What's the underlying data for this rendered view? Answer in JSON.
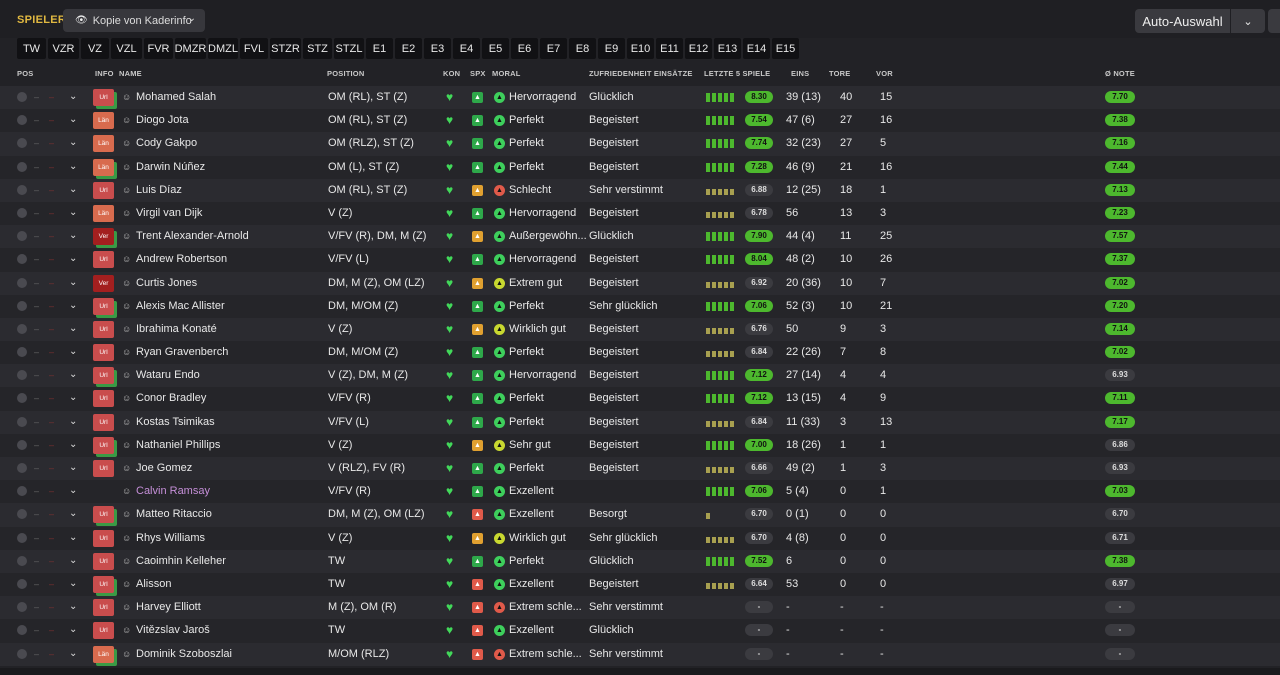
{
  "header": {
    "section_label": "SPIELER",
    "view_label": "Kopie von Kaderinfo",
    "auto_label": "Auto-Auswahl"
  },
  "positions": [
    "TW",
    "VZR",
    "VZ",
    "VZL",
    "FVR",
    "DMZR",
    "DMZL",
    "FVL",
    "STZR",
    "STZ",
    "STZL",
    "E1",
    "E2",
    "E3",
    "E4",
    "E5",
    "E6",
    "E7",
    "E8",
    "E9",
    "E10",
    "E11",
    "E12",
    "E13",
    "E14",
    "E15"
  ],
  "columns": {
    "pos": "POS",
    "info": "INFO",
    "name": "NAME",
    "position": "POSITION",
    "kon": "KON",
    "spx": "SPX",
    "moral": "MORAL",
    "zufriedenheit": "ZUFRIEDENHEIT EINSÄTZE",
    "letzte5": "LETZTE 5 SPIELE",
    "eins": "EINS",
    "tore": "TORE",
    "vor": "VOR",
    "note": "Ø NOTE"
  },
  "players": [
    {
      "info": "Url",
      "name": "Mohamed Salah",
      "position": "OM (RL), ST (Z)",
      "moral": "Hervorragend",
      "zufr": "Glücklich",
      "form": "8.30",
      "eins": "39 (13)",
      "tore": "40",
      "vor": "15",
      "note": "7.70"
    },
    {
      "info": "Län",
      "name": "Diogo Jota",
      "position": "OM (RL), ST (Z)",
      "moral": "Perfekt",
      "zufr": "Begeistert",
      "form": "7.54",
      "eins": "47 (6)",
      "tore": "27",
      "vor": "16",
      "note": "7.38"
    },
    {
      "info": "Län",
      "name": "Cody Gakpo",
      "position": "OM (RLZ), ST (Z)",
      "moral": "Perfekt",
      "zufr": "Begeistert",
      "form": "7.74",
      "eins": "32 (23)",
      "tore": "27",
      "vor": "5",
      "note": "7.16"
    },
    {
      "info": "Län",
      "name": "Darwin Núñez",
      "position": "OM (L), ST (Z)",
      "moral": "Perfekt",
      "zufr": "Begeistert",
      "form": "7.28",
      "eins": "46 (9)",
      "tore": "21",
      "vor": "16",
      "note": "7.44"
    },
    {
      "info": "Url",
      "name": "Luis Díaz",
      "position": "OM (RL), ST (Z)",
      "moral": "Schlecht",
      "zufr": "Sehr verstimmt",
      "form": "6.88",
      "eins": "12 (25)",
      "tore": "18",
      "vor": "1",
      "note": "7.13"
    },
    {
      "info": "Län",
      "name": "Virgil van Dijk",
      "position": "V (Z)",
      "moral": "Hervorragend",
      "zufr": "Begeistert",
      "form": "6.78",
      "eins": "56",
      "tore": "13",
      "vor": "3",
      "note": "7.23"
    },
    {
      "info": "Ver",
      "name": "Trent Alexander-Arnold",
      "position": "V/FV (R), DM, M (Z)",
      "moral": "Außergewöhn...",
      "zufr": "Glücklich",
      "form": "7.90",
      "eins": "44 (4)",
      "tore": "11",
      "vor": "25",
      "note": "7.57"
    },
    {
      "info": "Url",
      "name": "Andrew Robertson",
      "position": "V/FV (L)",
      "moral": "Hervorragend",
      "zufr": "Begeistert",
      "form": "8.04",
      "eins": "48 (2)",
      "tore": "10",
      "vor": "26",
      "note": "7.37"
    },
    {
      "info": "Ver",
      "name": "Curtis Jones",
      "position": "DM, M (Z), OM (LZ)",
      "moral": "Extrem gut",
      "zufr": "Begeistert",
      "form": "6.92",
      "eins": "20 (36)",
      "tore": "10",
      "vor": "7",
      "note": "7.02"
    },
    {
      "info": "Url",
      "name": "Alexis Mac Allister",
      "position": "DM, M/OM (Z)",
      "moral": "Perfekt",
      "zufr": "Sehr glücklich",
      "form": "7.06",
      "eins": "52 (3)",
      "tore": "10",
      "vor": "21",
      "note": "7.20"
    },
    {
      "info": "Url",
      "name": "Ibrahima Konaté",
      "position": "V (Z)",
      "moral": "Wirklich gut",
      "zufr": "Begeistert",
      "form": "6.76",
      "eins": "50",
      "tore": "9",
      "vor": "3",
      "note": "7.14"
    },
    {
      "info": "Url",
      "name": "Ryan Gravenberch",
      "position": "DM, M/OM (Z)",
      "moral": "Perfekt",
      "zufr": "Begeistert",
      "form": "6.84",
      "eins": "22 (26)",
      "tore": "7",
      "vor": "8",
      "note": "7.02"
    },
    {
      "info": "Url",
      "name": "Wataru Endo",
      "position": "V (Z), DM, M (Z)",
      "moral": "Hervorragend",
      "zufr": "Begeistert",
      "form": "7.12",
      "eins": "27 (14)",
      "tore": "4",
      "vor": "4",
      "note": "6.93"
    },
    {
      "info": "Url",
      "name": "Conor Bradley",
      "position": "V/FV (R)",
      "moral": "Perfekt",
      "zufr": "Begeistert",
      "form": "7.12",
      "eins": "13 (15)",
      "tore": "4",
      "vor": "9",
      "note": "7.11"
    },
    {
      "info": "Url",
      "name": "Kostas Tsimikas",
      "position": "V/FV (L)",
      "moral": "Perfekt",
      "zufr": "Begeistert",
      "form": "6.84",
      "eins": "11 (33)",
      "tore": "3",
      "vor": "13",
      "note": "7.17"
    },
    {
      "info": "Url",
      "name": "Nathaniel Phillips",
      "position": "V (Z)",
      "moral": "Sehr gut",
      "zufr": "Begeistert",
      "form": "7.00",
      "eins": "18 (26)",
      "tore": "1",
      "vor": "1",
      "note": "6.86"
    },
    {
      "info": "Url",
      "name": "Joe Gomez",
      "position": "V (RLZ), FV (R)",
      "moral": "Perfekt",
      "zufr": "Begeistert",
      "form": "6.66",
      "eins": "49 (2)",
      "tore": "1",
      "vor": "3",
      "note": "6.93"
    },
    {
      "info": "",
      "name": "Calvin Ramsay",
      "position": "V/FV (R)",
      "moral": "Exzellent",
      "zufr": "",
      "form": "7.06",
      "eins": "5 (4)",
      "tore": "0",
      "vor": "1",
      "note": "7.03"
    },
    {
      "info": "Url",
      "name": "Matteo Ritaccio",
      "position": "DM, M (Z), OM (LZ)",
      "moral": "Exzellent",
      "zufr": "Besorgt",
      "form": "6.70",
      "eins": "0 (1)",
      "tore": "0",
      "vor": "0",
      "note": "6.70"
    },
    {
      "info": "Url",
      "name": "Rhys Williams",
      "position": "V (Z)",
      "moral": "Wirklich gut",
      "zufr": "Sehr glücklich",
      "form": "6.70",
      "eins": "4 (8)",
      "tore": "0",
      "vor": "0",
      "note": "6.71"
    },
    {
      "info": "Url",
      "name": "Caoimhin Kelleher",
      "position": "TW",
      "moral": "Perfekt",
      "zufr": "Glücklich",
      "form": "7.52",
      "eins": "6",
      "tore": "0",
      "vor": "0",
      "note": "7.38"
    },
    {
      "info": "Url",
      "name": "Alisson",
      "position": "TW",
      "moral": "Exzellent",
      "zufr": "Begeistert",
      "form": "6.64",
      "eins": "53",
      "tore": "0",
      "vor": "0",
      "note": "6.97"
    },
    {
      "info": "Url",
      "name": "Harvey Elliott",
      "position": "M (Z), OM (R)",
      "moral": "Extrem schle...",
      "zufr": "Sehr verstimmt",
      "form": "-",
      "eins": "-",
      "tore": "-",
      "vor": "-",
      "note": "-"
    },
    {
      "info": "Url",
      "name": "Vitězslav Jaroš",
      "position": "TW",
      "moral": "Exzellent",
      "zufr": "Glücklich",
      "form": "-",
      "eins": "-",
      "tore": "-",
      "vor": "-",
      "note": "-"
    },
    {
      "info": "Län",
      "name": "Dominik Szoboszlai",
      "position": "M/OM (RLZ)",
      "moral": "Extrem schle...",
      "zufr": "Sehr verstimmt",
      "form": "-",
      "eins": "-",
      "tore": "-",
      "vor": "-",
      "note": "-"
    }
  ],
  "colors": {
    "accent": "#e0b841",
    "form_green": "#4db82e",
    "kon_green": "#42d85a",
    "badge_url": "#c94d4d",
    "badge_ver": "#a31f1f"
  }
}
